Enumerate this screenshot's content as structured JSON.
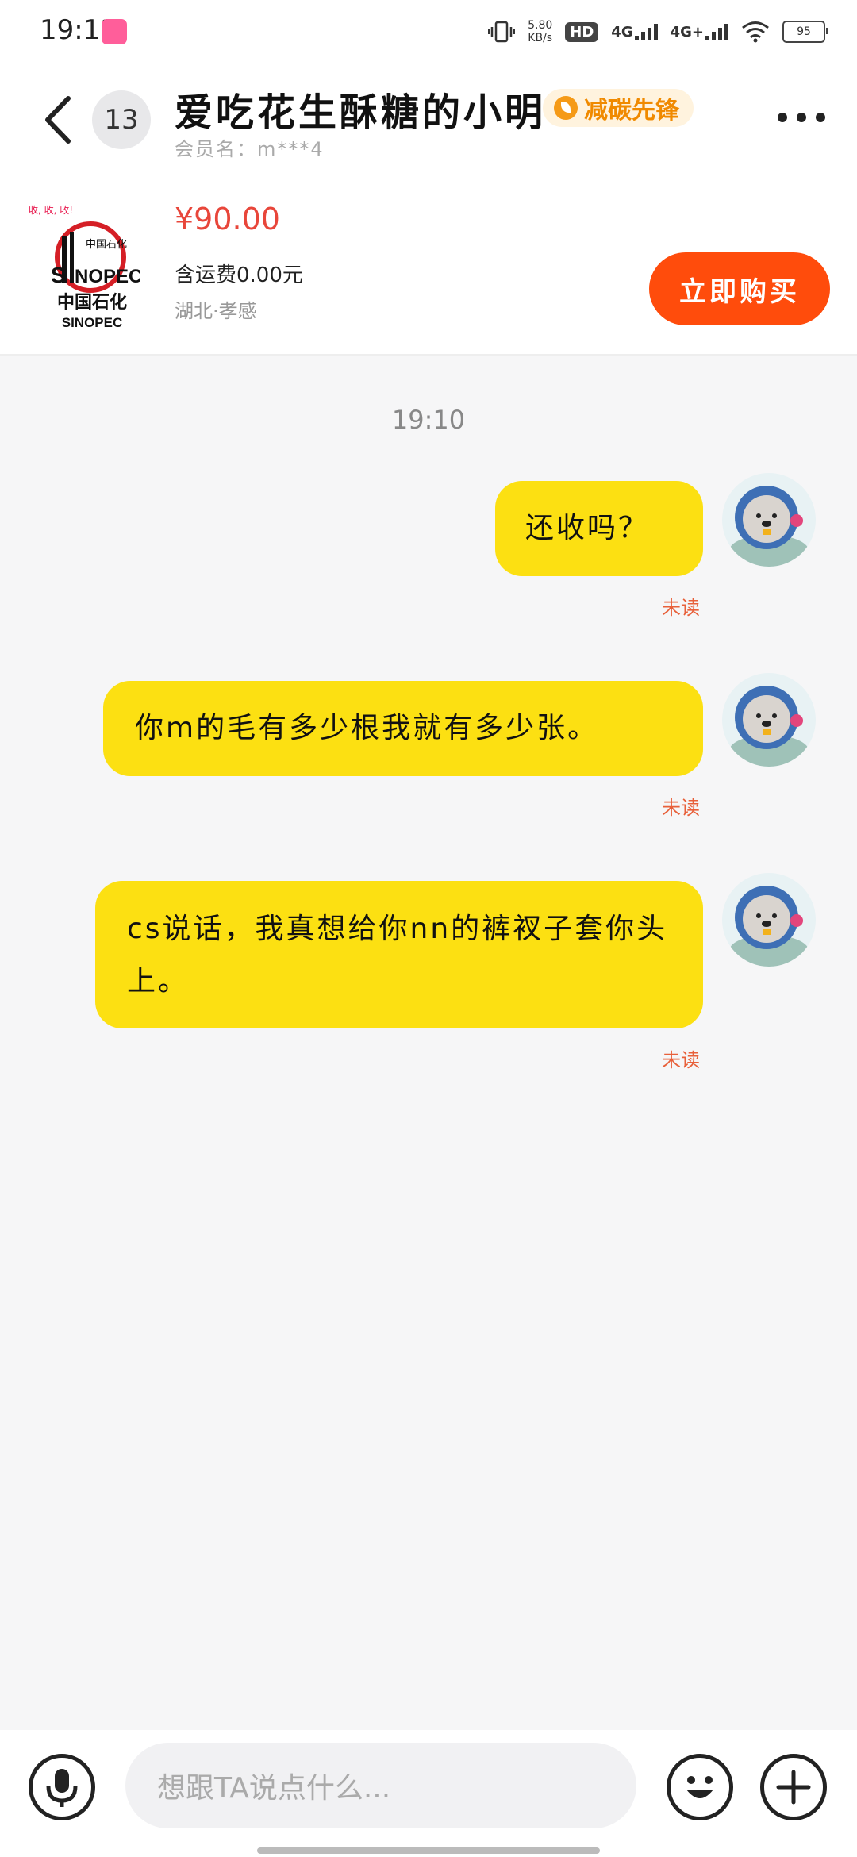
{
  "status_bar": {
    "time": "19:13",
    "net_speed_value": "5.80",
    "net_speed_unit": "KB/s",
    "hd_label": "HD",
    "signal_1": "4G",
    "signal_2": "4G+",
    "battery": "95"
  },
  "header": {
    "unread_count": "13",
    "nickname": "爱吃花生酥糖的小明",
    "badge": "减碳先锋",
    "member_name": "会员名：m***4"
  },
  "product": {
    "tag": "收, 收, 收!",
    "logo_text_cn": "中国石化",
    "logo_text_en": "SINOPEC",
    "price": "¥90.00",
    "shipping": "含运费0.00元",
    "location": "湖北·孝感",
    "buy_label": "立即购买"
  },
  "chat": {
    "timestamp": "19:10",
    "messages": [
      {
        "text": "还收吗？",
        "status": "未读"
      },
      {
        "text": "你m的毛有多少根我就有多少张。",
        "status": "未读"
      },
      {
        "text": "cs说话，我真想给你nn的裤衩子套你头上。",
        "status": "未读"
      }
    ]
  },
  "input": {
    "placeholder": "想跟TA说点什么..."
  },
  "colors": {
    "bubble": "#fce012",
    "buy_button": "#ff4c0c",
    "price": "#e8463a",
    "badge_text": "#f08a00",
    "unread": "#e8603a"
  }
}
